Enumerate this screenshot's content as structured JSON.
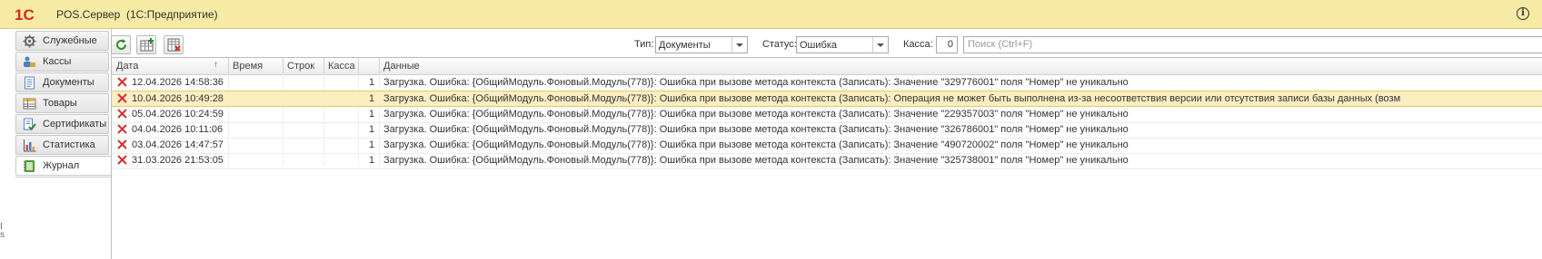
{
  "window": {
    "logo_text": "1С",
    "title": "POS.Сервер  (1С:Предприятие)"
  },
  "icons": {
    "logo": "1c-logo-icon",
    "info": "info-icon",
    "refresh": "refresh-icon",
    "add": "table-add-icon",
    "delete": "table-delete-icon",
    "error": "error-x-icon"
  },
  "info_glyph": "i",
  "sidebar": {
    "items": [
      {
        "label": "Служебные",
        "icon": "gear-icon"
      },
      {
        "label": "Кассы",
        "icon": "cashier-icon"
      },
      {
        "label": "Документы",
        "icon": "document-icon"
      },
      {
        "label": "Товары",
        "icon": "goods-table-icon"
      },
      {
        "label": "Сертификаты",
        "icon": "certificate-icon"
      },
      {
        "label": "Статистика",
        "icon": "statistics-icon"
      },
      {
        "label": "Журнал",
        "icon": "journal-icon",
        "active": true
      }
    ],
    "edge_chars": [
      "I",
      "s"
    ]
  },
  "filters": {
    "type_label": "Тип:",
    "type_value": "Документы",
    "status_label": "Статус:",
    "status_value": "Ошибка",
    "cashbox_label": "Касса:",
    "cashbox_value": "0",
    "search_placeholder": "Поиск (Ctrl+F)"
  },
  "table": {
    "columns": [
      "Дата",
      "Время",
      "Строк",
      "Касса",
      "",
      "Данные"
    ],
    "sort_indicator": "↑",
    "rows": [
      {
        "date": "12.04.2026 14:58:36",
        "count": "1",
        "data": "Загрузка. Ошибка: {ОбщийМодуль.Фоновый.Модуль(778)}: Ошибка при вызове метода контекста (Записать): Значение \"329776001\" поля \"Номер\" не уникально",
        "selected": false
      },
      {
        "date": "10.04.2026 10:49:28",
        "count": "1",
        "data": "Загрузка. Ошибка: {ОбщийМодуль.Фоновый.Модуль(778)}: Ошибка при вызове метода контекста (Записать): Операция не может быть выполнена из-за несоответствия версии или отсутствия записи базы данных (возм",
        "selected": true
      },
      {
        "date": "05.04.2026 10:24:59",
        "count": "1",
        "data": "Загрузка. Ошибка: {ОбщийМодуль.Фоновый.Модуль(778)}: Ошибка при вызове метода контекста (Записать): Значение \"229357003\" поля \"Номер\" не уникально",
        "selected": false
      },
      {
        "date": "04.04.2026 10:11:06",
        "count": "1",
        "data": "Загрузка. Ошибка: {ОбщийМодуль.Фоновый.Модуль(778)}: Ошибка при вызове метода контекста (Записать): Значение \"326786001\" поля \"Номер\" не уникально",
        "selected": false
      },
      {
        "date": "03.04.2026 14:47:57",
        "count": "1",
        "data": "Загрузка. Ошибка: {ОбщийМодуль.Фоновый.Модуль(778)}: Ошибка при вызове метода контекста (Записать): Значение \"490720002\" поля \"Номер\" не уникально",
        "selected": false
      },
      {
        "date": "31.03.2026 21:53:05",
        "count": "1",
        "data": "Загрузка. Ошибка: {ОбщийМодуль.Фоновый.Модуль(778)}: Ошибка при вызове метода контекста (Записать): Значение \"325738001\" поля \"Номер\" не уникально",
        "selected": false
      }
    ]
  },
  "colors": {
    "titlebar": "#f7eaa5",
    "selected_row": "#fbeec0",
    "error_red": "#d32f2f",
    "refresh_green": "#2e8b2e"
  }
}
